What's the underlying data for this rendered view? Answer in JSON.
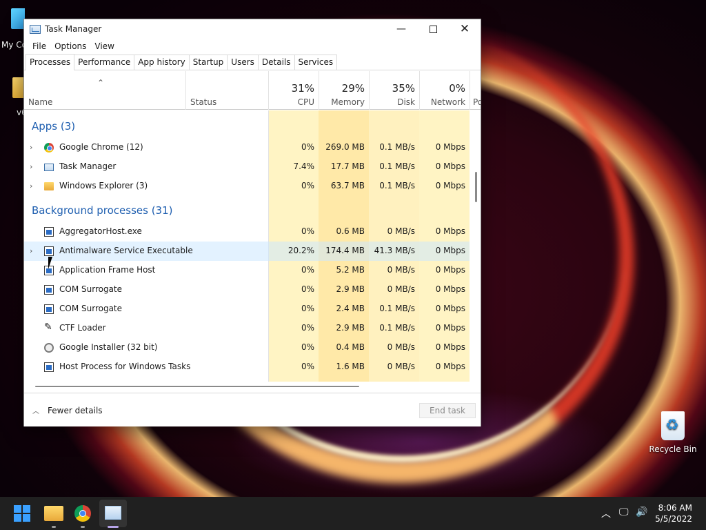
{
  "desktop": {
    "icons": [
      {
        "label": "My Co"
      },
      {
        "label": "v6"
      },
      {
        "label": "Recycle Bin"
      }
    ]
  },
  "window": {
    "title": "Task Manager",
    "menu": [
      "File",
      "Options",
      "View"
    ],
    "tabs": [
      "Processes",
      "Performance",
      "App history",
      "Startup",
      "Users",
      "Details",
      "Services"
    ],
    "active_tab": "Processes",
    "columns": {
      "name": "Name",
      "status": "Status",
      "cpu": {
        "pct": "31%",
        "label": "CPU"
      },
      "memory": {
        "pct": "29%",
        "label": "Memory"
      },
      "disk": {
        "pct": "35%",
        "label": "Disk"
      },
      "network": {
        "pct": "0%",
        "label": "Network"
      },
      "power": "Po"
    },
    "groups": {
      "apps": "Apps (3)",
      "background": "Background processes (31)"
    },
    "apps": [
      {
        "name": "Google Chrome (12)",
        "cpu": "0%",
        "memory": "269.0 MB",
        "disk": "0.1 MB/s",
        "network": "0 Mbps",
        "icon": "chrome-icon"
      },
      {
        "name": "Task Manager",
        "cpu": "7.4%",
        "memory": "17.7 MB",
        "disk": "0.1 MB/s",
        "network": "0 Mbps",
        "icon": "task-manager-icon"
      },
      {
        "name": "Windows Explorer (3)",
        "cpu": "0%",
        "memory": "63.7 MB",
        "disk": "0.1 MB/s",
        "network": "0 Mbps",
        "icon": "folder-icon"
      }
    ],
    "background": [
      {
        "name": "AggregatorHost.exe",
        "cpu": "0%",
        "memory": "0.6 MB",
        "disk": "0 MB/s",
        "network": "0 Mbps",
        "icon": "app-icon"
      },
      {
        "name": "Antimalware Service Executable",
        "cpu": "20.2%",
        "memory": "174.4 MB",
        "disk": "41.3 MB/s",
        "network": "0 Mbps",
        "icon": "app-icon"
      },
      {
        "name": "Application Frame Host",
        "cpu": "0%",
        "memory": "5.2 MB",
        "disk": "0 MB/s",
        "network": "0 Mbps",
        "icon": "app-icon"
      },
      {
        "name": "COM Surrogate",
        "cpu": "0%",
        "memory": "2.9 MB",
        "disk": "0 MB/s",
        "network": "0 Mbps",
        "icon": "app-icon"
      },
      {
        "name": "COM Surrogate",
        "cpu": "0%",
        "memory": "2.4 MB",
        "disk": "0.1 MB/s",
        "network": "0 Mbps",
        "icon": "app-icon"
      },
      {
        "name": "CTF Loader",
        "cpu": "0%",
        "memory": "2.9 MB",
        "disk": "0.1 MB/s",
        "network": "0 Mbps",
        "icon": "pen-icon"
      },
      {
        "name": "Google Installer (32 bit)",
        "cpu": "0%",
        "memory": "0.4 MB",
        "disk": "0 MB/s",
        "network": "0 Mbps",
        "icon": "gear-icon"
      },
      {
        "name": "Host Process for Windows Tasks",
        "cpu": "0%",
        "memory": "1.6 MB",
        "disk": "0 MB/s",
        "network": "0 Mbps",
        "icon": "app-icon"
      }
    ],
    "footer": {
      "fewer_details": "Fewer details",
      "end_task": "End task"
    }
  },
  "taskbar": {
    "time": "8:06 AM",
    "date": "5/5/2022"
  },
  "colors": {
    "heat_light": "#fff4c4",
    "heat_medium": "#ffe9a8",
    "heat_strong": "#f9dea0",
    "group_text": "#1f5fb0",
    "selected_row": "#cce8ff"
  }
}
